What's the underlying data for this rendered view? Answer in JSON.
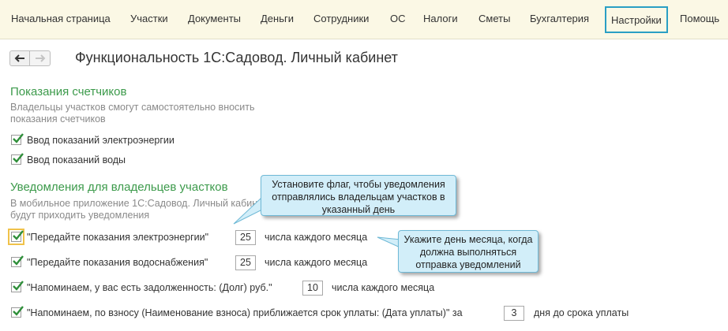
{
  "menu": {
    "items": [
      {
        "key": "home",
        "label": "Начальная страница"
      },
      {
        "key": "plots",
        "label": "Участки"
      },
      {
        "key": "documents",
        "label": "Документы"
      },
      {
        "key": "money",
        "label": "Деньги"
      },
      {
        "key": "employees",
        "label": "Сотрудники"
      },
      {
        "key": "os",
        "label": "ОС"
      },
      {
        "key": "taxes",
        "label": "Налоги"
      },
      {
        "key": "estimates",
        "label": "Сметы"
      },
      {
        "key": "accounting",
        "label": "Бухгалтерия"
      },
      {
        "key": "settings",
        "label": "Настройки"
      },
      {
        "key": "help",
        "label": "Помощь"
      }
    ],
    "active": "settings"
  },
  "header": {
    "title": "Функциональность 1С:Садовод. Личный кабинет"
  },
  "meters": {
    "title": "Показания счетчиков",
    "hint": "Владельцы участков смогут самостоятельно вносить показания счетчиков",
    "options": [
      {
        "label": "Ввод показаний электроэнергии",
        "checked": true
      },
      {
        "label": "Ввод показаний воды",
        "checked": true
      }
    ]
  },
  "notifications": {
    "title": "Уведомления для владельцев участков",
    "hint": "В мобильное приложение 1С:Садовод. Личный кабинет будут приходить уведомления",
    "rows": [
      {
        "label": "\"Передайте показания электроэнергии\"",
        "value": "25",
        "suffix": "числа каждого месяца",
        "checked": true
      },
      {
        "label": "\"Передайте показания водоснабжения\"",
        "value": "25",
        "suffix": "числа каждого месяца",
        "checked": true
      },
      {
        "label": "\"Напоминаем, у вас есть задолженность: (Долг) руб.\"",
        "value": "10",
        "suffix": "числа каждого месяца",
        "checked": true
      },
      {
        "label": "\"Напоминаем, по взносу (Наименование взноса) приближается срок уплаты: (Дата уплаты)\" за",
        "value": "3",
        "suffix": "дня до срока уплаты",
        "checked": true
      }
    ]
  },
  "callouts": {
    "flag": "Установите флаг, чтобы уведомления отправлялись владельцам участков в указанный день",
    "day": "Укажите день месяца, когда должна выполняться отправка уведомлений"
  },
  "colors": {
    "accent_green": "#3c9a4b",
    "highlight_blue": "#2a9fc4",
    "callout_bg": "#d2eef9",
    "checkbox_frame": "#f0c24a",
    "topbar_bg": "#fbf8e5"
  }
}
